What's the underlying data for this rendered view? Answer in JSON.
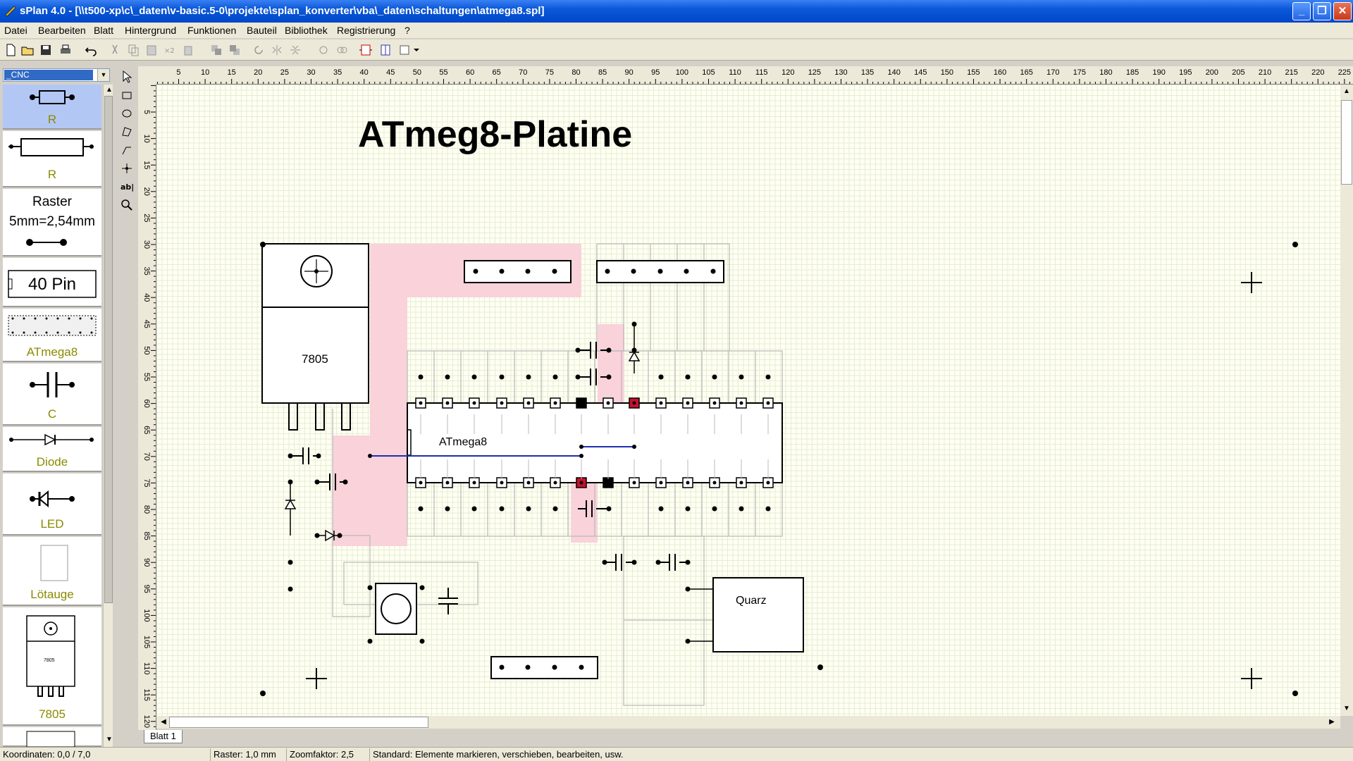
{
  "window": {
    "title": "sPlan 4.0 - [\\\\t500-xp\\c\\_daten\\v-basic.5-0\\projekte\\splan_konverter\\vba\\_daten\\schaltungen\\atmega8.spl]"
  },
  "menu": {
    "items": [
      "Datei",
      "Bearbeiten",
      "Blatt",
      "Hintergrund",
      "Funktionen",
      "Bauteil",
      "Bibliothek",
      "Registrierung",
      "?"
    ]
  },
  "library": {
    "selected": "_CNC",
    "items": [
      {
        "label": "R"
      },
      {
        "label": "R"
      },
      {
        "text1": "Raster",
        "text2": "5mm=2,54mm"
      },
      {
        "text1": "40 Pin"
      },
      {
        "label": "ATmega8"
      },
      {
        "label": "C"
      },
      {
        "label": "Diode"
      },
      {
        "label": "LED"
      },
      {
        "label": "Lötauge"
      },
      {
        "label": "7805",
        "chip_text": "7805"
      }
    ]
  },
  "ruler": {
    "h_labels": [
      "5",
      "10",
      "15",
      "20",
      "25",
      "30",
      "35",
      "40",
      "45",
      "50",
      "55",
      "60",
      "65",
      "70",
      "75",
      "80",
      "85",
      "90",
      "95",
      "100",
      "105",
      "110",
      "115",
      "120",
      "125",
      "130",
      "135",
      "140",
      "145",
      "150",
      "155",
      "160",
      "165",
      "170",
      "175",
      "180",
      "185",
      "190",
      "195",
      "200",
      "205",
      "210",
      "215",
      "220",
      "225"
    ],
    "v_labels": [
      "5",
      "10",
      "15",
      "20",
      "25",
      "30",
      "35",
      "40",
      "45",
      "50",
      "55",
      "60",
      "65",
      "70",
      "75",
      "80",
      "85",
      "90",
      "95",
      "100",
      "105",
      "110",
      "115",
      "120"
    ]
  },
  "drawing": {
    "title": "ATmeg8-Platine",
    "regulator_label": "7805",
    "chip_label": "ATmega8",
    "crystal_label": "Quarz"
  },
  "tabs": [
    "Blatt 1"
  ],
  "status": {
    "coords": "Koordinaten: 0,0 / 7,0",
    "raster": "Raster: 1,0 mm",
    "zoom": "Zoomfaktor: 2,5",
    "mode": "Standard: Elemente markieren, verschieben, bearbeiten, usw."
  },
  "colors": {
    "accent": "#316ac5",
    "pink_area": "#f9d2da",
    "wire": "#1f2fb0",
    "red_pad": "#c8102e"
  }
}
